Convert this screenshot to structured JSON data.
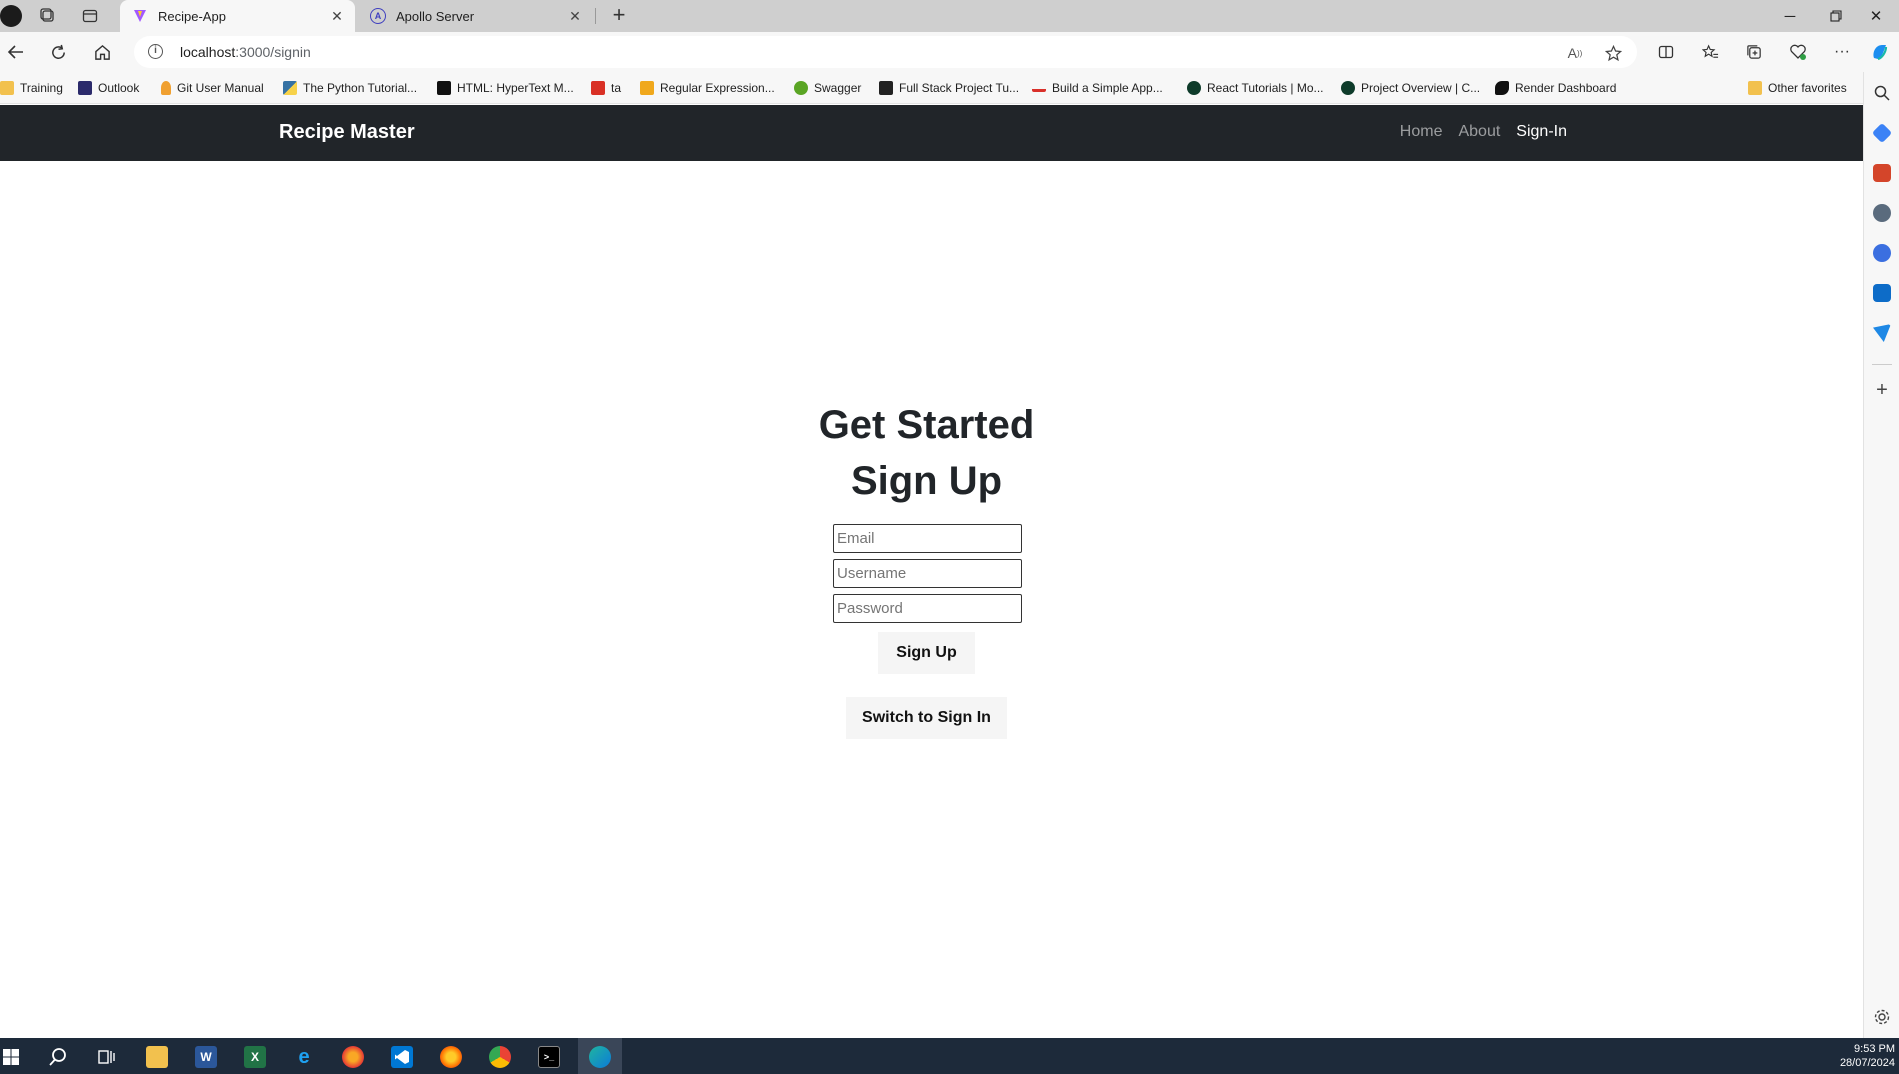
{
  "browser": {
    "tabs": [
      {
        "title": "Recipe-App",
        "active": true,
        "icon": "vite-icon"
      },
      {
        "title": "Apollo Server",
        "active": false,
        "icon": "apollo-icon"
      }
    ],
    "address": {
      "host": "localhost",
      "path": ":3000/signin"
    },
    "bookmarks": [
      {
        "label": "Training",
        "icon": "folder-icon"
      },
      {
        "label": "Outlook",
        "icon": "outlook-icon"
      },
      {
        "label": "Git User Manual",
        "icon": "git-icon"
      },
      {
        "label": "The Python Tutorial...",
        "icon": "python-icon"
      },
      {
        "label": "HTML: HyperText M...",
        "icon": "mdn-icon"
      },
      {
        "label": "ta",
        "icon": "pdf-icon"
      },
      {
        "label": "Regular Expression...",
        "icon": "js-icon"
      },
      {
        "label": "Swagger",
        "icon": "swagger-icon"
      },
      {
        "label": "Full Stack Project Tu...",
        "icon": "project-icon"
      },
      {
        "label": "Build a Simple App...",
        "icon": "link-icon"
      },
      {
        "label": "React Tutorials | Mo...",
        "icon": "mongodb-icon"
      },
      {
        "label": "Project Overview | C...",
        "icon": "mongodb-icon"
      },
      {
        "label": "Render Dashboard",
        "icon": "render-icon"
      },
      {
        "label": "Other favorites",
        "icon": "folder-icon"
      }
    ]
  },
  "app": {
    "brand": "Recipe Master",
    "nav": [
      {
        "label": "Home",
        "active": false
      },
      {
        "label": "About",
        "active": false
      },
      {
        "label": "Sign-In",
        "active": true
      }
    ],
    "heading": "Get Started",
    "subheading": "Sign Up",
    "form": {
      "email_placeholder": "Email",
      "username_placeholder": "Username",
      "password_placeholder": "Password",
      "submit_label": "Sign Up",
      "switch_label": "Switch to Sign In"
    }
  },
  "taskbar": {
    "time": "9:53 PM",
    "date": "28/07/2024"
  },
  "colors": {
    "navbar_bg": "#212529",
    "button_bg": "#f5f5f5",
    "taskbar_bg": "#1d2a3a"
  }
}
